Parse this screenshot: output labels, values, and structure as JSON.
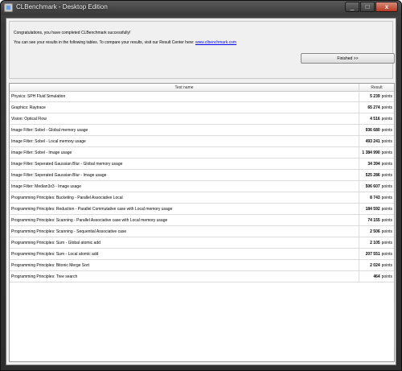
{
  "window": {
    "title": "CLBenchmark - Desktop Edition",
    "buttons": {
      "minimize": "_",
      "maximize": "□",
      "close": "x"
    }
  },
  "header": {
    "line1": "Congratulations, you have completed CLBenchmark successfully!",
    "line2_prefix": "You can see your results in the following tables. To compare your results, visit our Result Center here:",
    "link_text": "www.clbenchmark.com",
    "finish_button": "Finished >>"
  },
  "table": {
    "columns": {
      "name": "Test name",
      "result": "Result"
    },
    "unit": "points",
    "rows": [
      {
        "name": "Physics: SPH Fluid Simulation",
        "value": "5 239"
      },
      {
        "name": "Graphics: Raytrace",
        "value": "65 274"
      },
      {
        "name": "Vision: Optical Flow",
        "value": "4 516"
      },
      {
        "name": "Image Filter: Sobel - Global memory usage",
        "value": "936 680"
      },
      {
        "name": "Image Filter: Sobel - Local memory usage",
        "value": "493 241"
      },
      {
        "name": "Image Filter: Sobel - Image usage",
        "value": "1 384 990"
      },
      {
        "name": "Image Filter: Seperated Gaussian Blur - Global memory usage",
        "value": "34 394"
      },
      {
        "name": "Image Filter: Seperated Gaussian Blur - Image usage",
        "value": "525 286"
      },
      {
        "name": "Image Filter: Median3x3 - Image usage",
        "value": "506 607"
      },
      {
        "name": "Programming Principles: Bucketing - Parallel Associative Local",
        "value": "8 743"
      },
      {
        "name": "Programming Principles: Reduction - Parallel Commutative case with Local memory usage",
        "value": "184 592"
      },
      {
        "name": "Programming Principles: Scanning - Parallel Associative case with Local memory usage",
        "value": "74 155"
      },
      {
        "name": "Programming Principles: Scanning - Sequential Associative case",
        "value": "2 506"
      },
      {
        "name": "Programming Principles: Sum - Global atomic add",
        "value": "2 105"
      },
      {
        "name": "Programming Principles: Sum - Local atomic add",
        "value": "207 551"
      },
      {
        "name": "Programming Principles: Bitonic Merge Sort",
        "value": "2 024"
      },
      {
        "name": "Programming Principles: Tree search",
        "value": "464"
      }
    ]
  }
}
